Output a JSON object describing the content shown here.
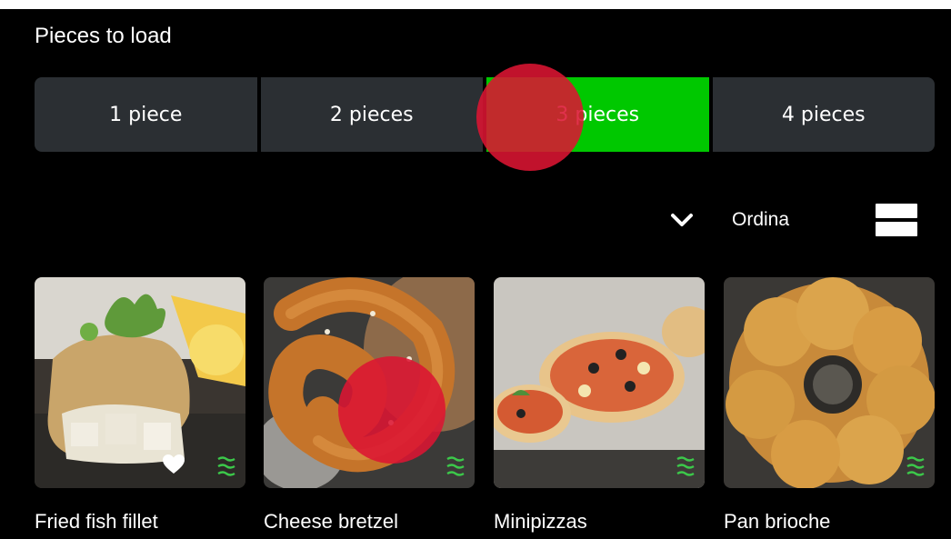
{
  "header": {
    "title": "Pieces to load"
  },
  "pieces_selector": {
    "options": [
      {
        "label": "1 piece",
        "selected": false
      },
      {
        "label": "2 pieces",
        "selected": false
      },
      {
        "label": "3 pieces",
        "selected": true
      },
      {
        "label": "4 pieces",
        "selected": false
      }
    ],
    "selected_color": "#00c800"
  },
  "sort_bar": {
    "label": "Ordina",
    "chevron_icon": "chevron-down-icon",
    "view_icon": "list-view-icon"
  },
  "recipes": [
    {
      "name": "Fried fish fillet",
      "favorite": true,
      "steam": true
    },
    {
      "name": "Cheese bretzel",
      "favorite": false,
      "steam": true
    },
    {
      "name": "Minipizzas",
      "favorite": false,
      "steam": true
    },
    {
      "name": "Pan brioche",
      "favorite": false,
      "steam": true
    }
  ],
  "colors": {
    "background": "#000000",
    "segment": "#2b2f33",
    "accent": "#00c800",
    "touch_marker": "#dc1432"
  }
}
